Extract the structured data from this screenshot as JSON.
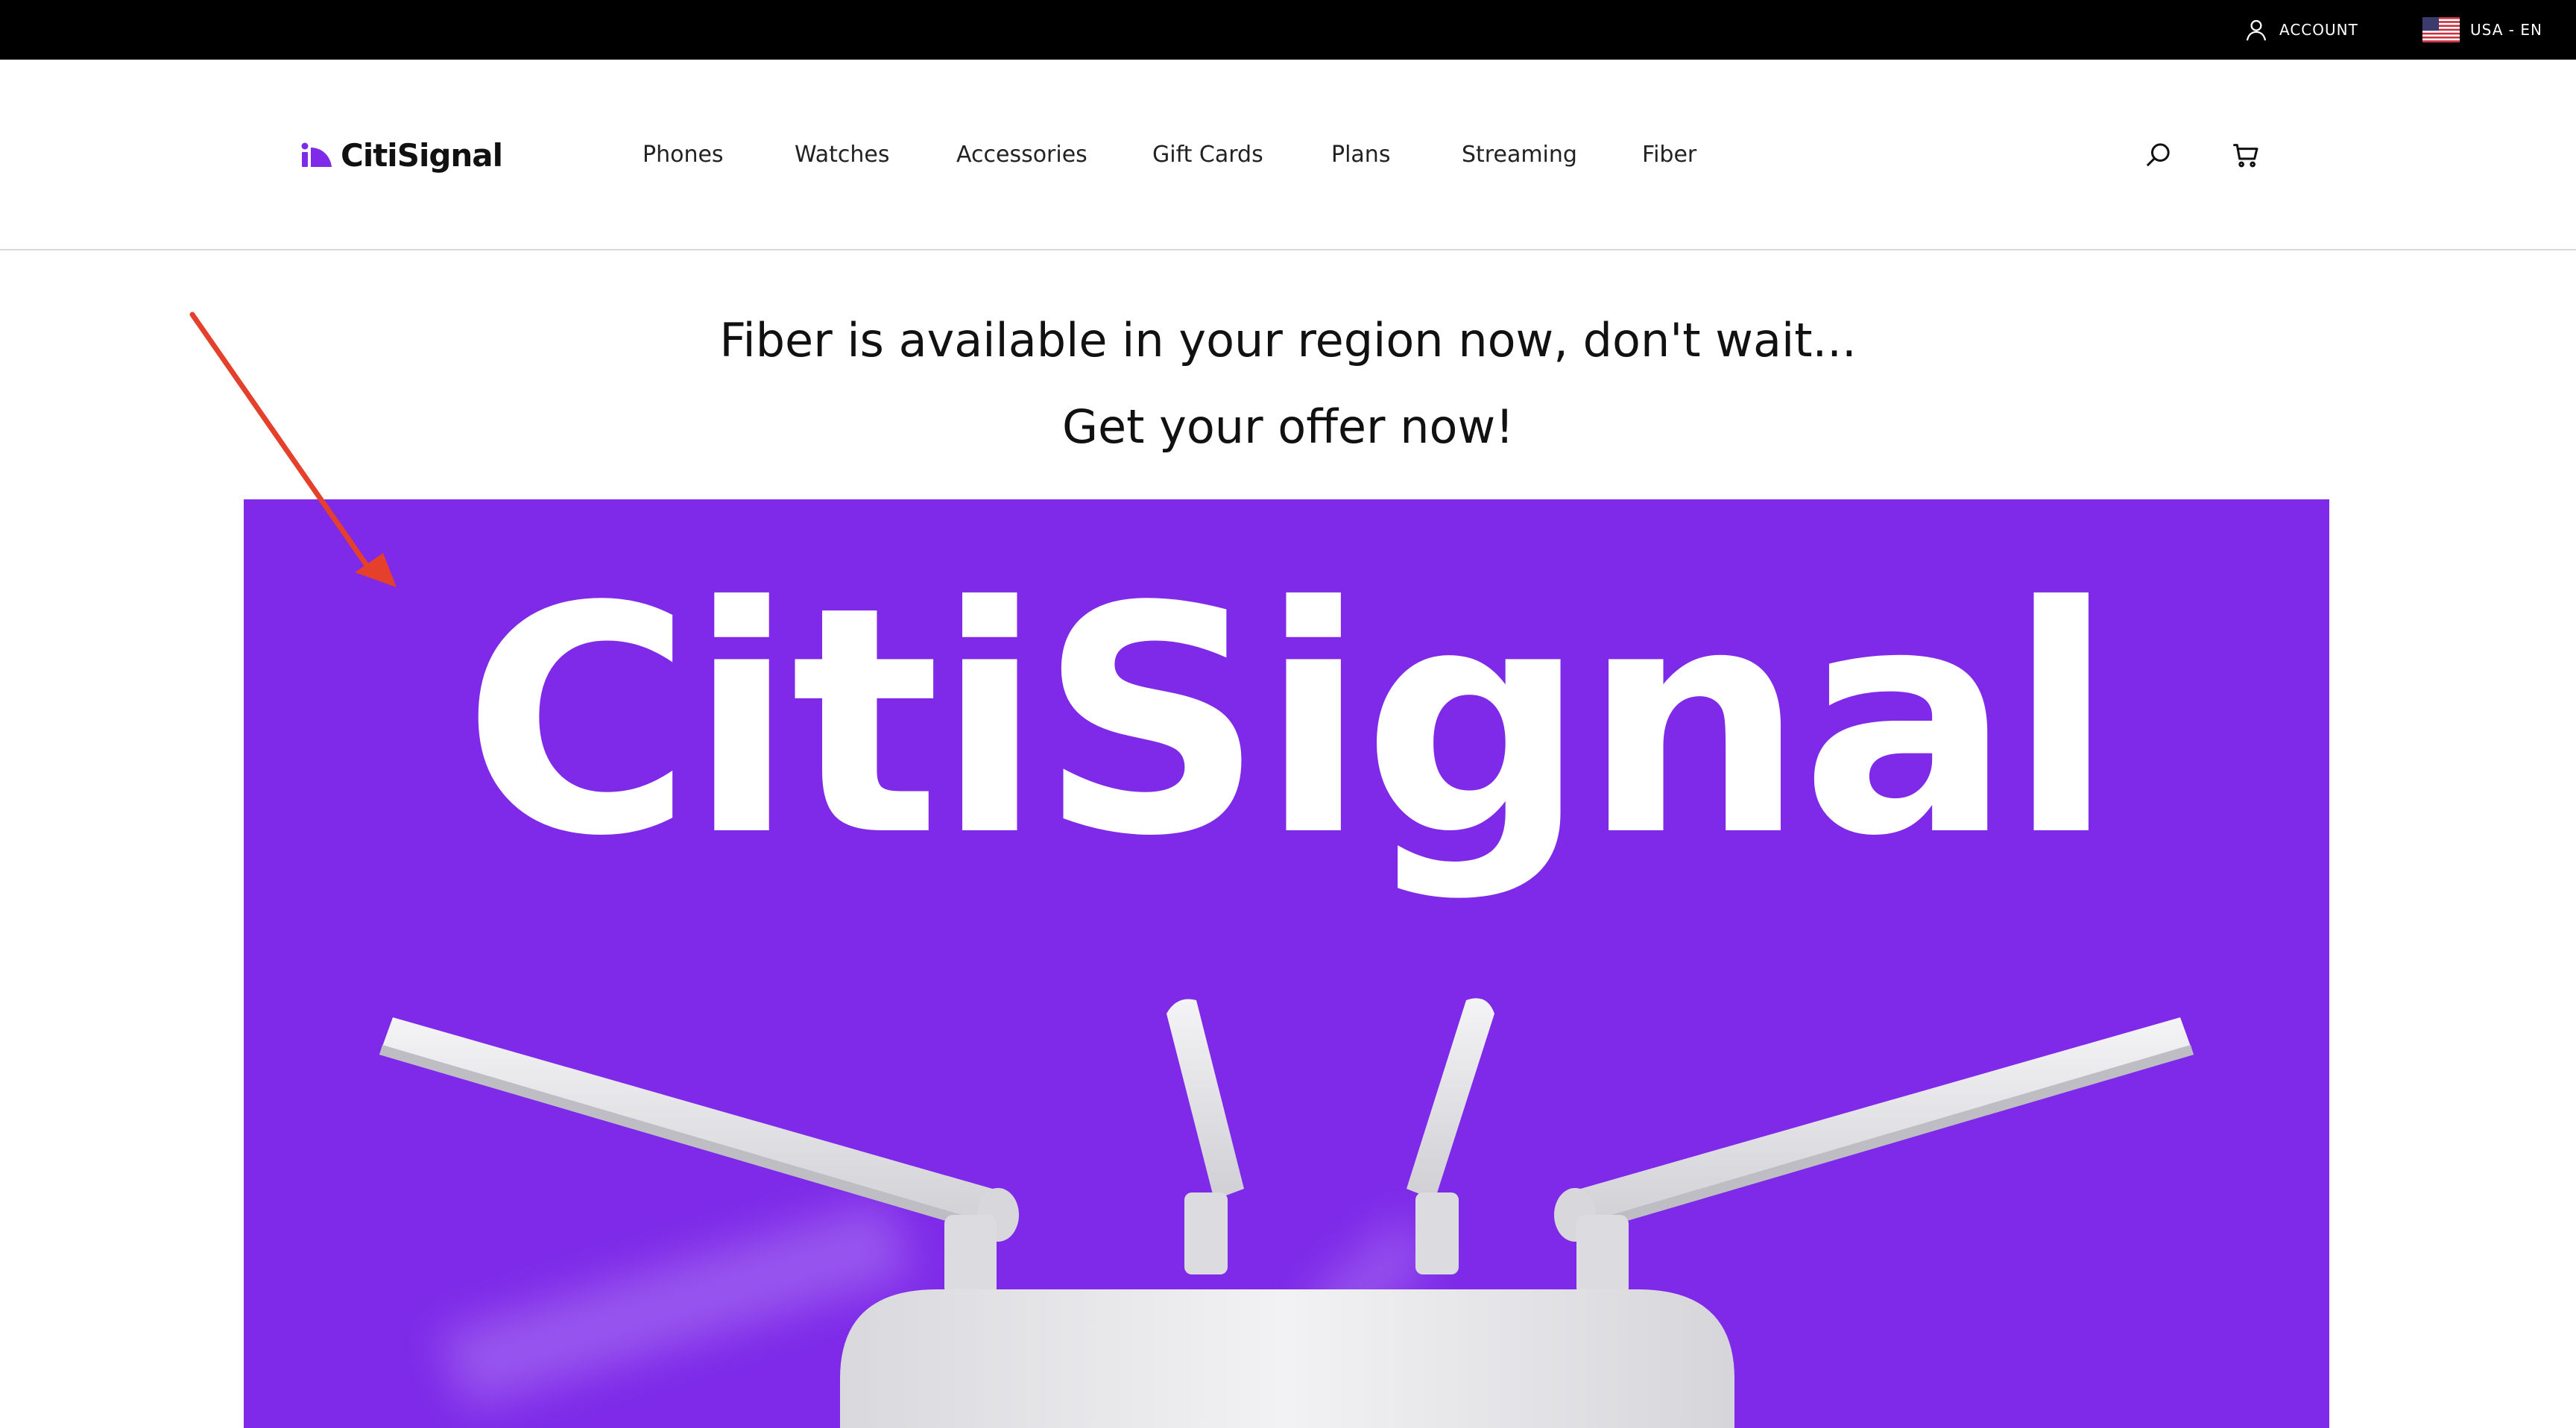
{
  "topbar": {
    "account_label": "ACCOUNT",
    "account_icon": "user-icon",
    "locale_label": "USA - EN",
    "locale_icon": "us-flag-icon"
  },
  "header": {
    "logo_text": "CitiSignal",
    "logo_icon": "citisignal-logo-icon",
    "nav": [
      "Phones",
      "Watches",
      "Accessories",
      "Gift Cards",
      "Plans",
      "Streaming",
      "Fiber"
    ],
    "search_icon": "search-icon",
    "cart_icon": "cart-icon"
  },
  "promo": {
    "line1": "Fiber is available in your region now, don't wait...",
    "line2": "Get your offer now!"
  },
  "hero": {
    "wordmark": "CitiSignal",
    "image": "wifi-router-image"
  },
  "colors": {
    "topbar_bg": "#000000",
    "brand_purple": "#7e2ae8",
    "annotation_red": "#e4402c"
  }
}
